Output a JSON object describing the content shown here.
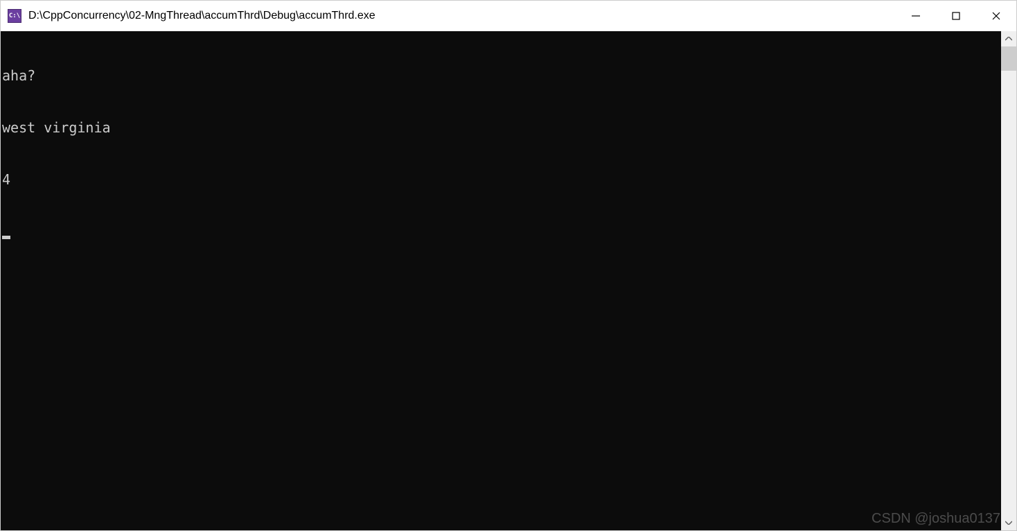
{
  "window": {
    "title": "D:\\CppConcurrency\\02-MngThread\\accumThrd\\Debug\\accumThrd.exe",
    "app_icon_text": "C:\\"
  },
  "console": {
    "lines": [
      "aha?",
      "west virginia",
      "4"
    ]
  },
  "watermark": "CSDN @joshua0137"
}
